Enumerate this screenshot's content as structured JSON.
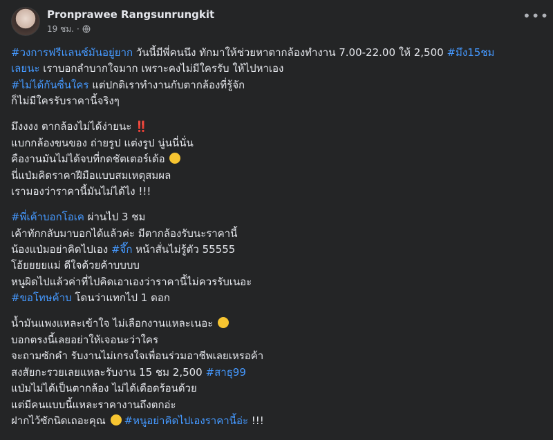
{
  "post": {
    "author": "Pronprawee Rangsunrungkit",
    "time": "19 ชม.",
    "separator": "·",
    "privacy_icon": "globe-icon",
    "more_icon": "more-options-icon",
    "colors": {
      "background": "#242526",
      "text": "#e4e6eb",
      "hashtag": "#4599ff",
      "muted": "#b0b3b8"
    }
  },
  "body": {
    "p1": {
      "l1": {
        "tag1": "#วงการฟรีแลนซ์มันอยู่ยาก",
        "text1": " วันนี้มีพี่คนนึง ทักมาให้ช่วยหาตากล้องทำงาน 7.00-22.00 ให้ 2,500 ",
        "tag2": "#มึง15ชม"
      },
      "l2": {
        "tag1": "เลยนะ",
        "text1": " เราบอกลำบากใจมาก เพราะคงไม่มีใครรับ ให้ไปหาเอง"
      },
      "l3": {
        "tag1": "#ไม่ได้กันซื่นใคร",
        "text1": " แต่ปกติเราทำงานกับตากล้องที่รู้จัก"
      },
      "l4": {
        "text1": "ก็ไม่มีใครรับราคานี้จริงๆ"
      }
    },
    "p2": {
      "l1": {
        "text1": "มึงงงง ตากล้องไม่ได้ง่ายนะ ",
        "emoji": "‼️"
      },
      "l2": {
        "text1": "แบกกล้องขนของ ถ่ายรูป แต่งรูป นู่นนี่นั่น"
      },
      "l3": {
        "text1": "คืองานมันไม่ได้จบที่กดชัตเตอร์เด้อ "
      },
      "l4": {
        "text1": "นี่แป่มคิดราคาฝีมือแบบสมเหตุสมผล"
      },
      "l5": {
        "text1": "เรามองว่าราคานี้มันไม่ได้ไง !!!"
      }
    },
    "p3": {
      "l1": {
        "tag1": "#พี่เค้าบอกโอเค",
        "text1": " ผ่านไป 3 ชม"
      },
      "l2": {
        "text1": "เค้าทักกลับมาบอกได้แล้วค่ะ มีตากล้องรับนะราคานี้"
      },
      "l3": {
        "text1": "น้องแป่มอย่าคิดไปเอง ",
        "tag1": "#จึ๊ก",
        "text2": " หน้าสั่นไม่รู้ตัว 55555"
      },
      "l4": {
        "text1": "โอ้ยยยยแม่ ดีใจด้วยค้าบบบบ"
      },
      "l5": {
        "text1": "หนูผิดไปแล้วค่าที่ไปคิดเอาเองว่าราคานี้ไม่ควรรับเนอะ"
      },
      "l6": {
        "tag1": "#ขอโทษค้าบ",
        "text1": " โดนว่าแทกไป 1 ดอก"
      }
    },
    "p4": {
      "l1": {
        "text1": "น้ำมันแพงแหละเข้าใจ ไม่เลือกงานแหละเนอะ "
      },
      "l2": {
        "text1": "บอกตรงนี้เลยอย่าให้เจอนะว่าใคร"
      },
      "l3": {
        "text1": "จะถามซักคำ รับงานไม่เกรงใจเพื่อนร่วมอาชีพเลยเหรอค้า"
      },
      "l4": {
        "text1": "สงสัยกะรวยเลยแหละรับงาน 15 ชม 2,500 ",
        "tag1": "#สาธุ99"
      },
      "l5": {
        "text1": "แป่มไม่ได้เป็นตากล้อง ไม่ได้เดือดร้อนด้วย"
      },
      "l6": {
        "text1": "แต่มีคนแบบนี้แหละราคางานถึงตกอ่ะ"
      },
      "l7": {
        "text1": "ฝากไว้ซักนิดเถอะคุณ ",
        "tag1": "#หนูอย่าคิดไปเองราคานี้อ่ะ",
        "text2": " !!!"
      }
    }
  }
}
